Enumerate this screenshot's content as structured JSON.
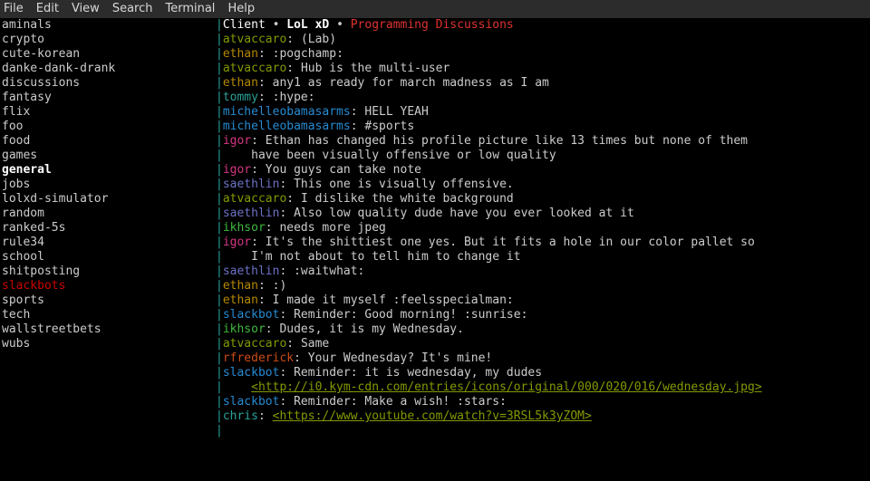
{
  "menubar": {
    "items": [
      "File",
      "Edit",
      "View",
      "Search",
      "Terminal",
      "Help"
    ]
  },
  "channels": [
    {
      "name": "aminals",
      "style": "ch"
    },
    {
      "name": "crypto",
      "style": "ch"
    },
    {
      "name": "cute-korean",
      "style": "ch"
    },
    {
      "name": "danke-dank-drank",
      "style": "ch"
    },
    {
      "name": "discussions",
      "style": "ch"
    },
    {
      "name": "fantasy",
      "style": "ch"
    },
    {
      "name": "flix",
      "style": "ch"
    },
    {
      "name": "foo",
      "style": "ch"
    },
    {
      "name": "food",
      "style": "ch"
    },
    {
      "name": "games",
      "style": "ch"
    },
    {
      "name": "general",
      "style": "ch-general"
    },
    {
      "name": "jobs",
      "style": "ch"
    },
    {
      "name": "lolxd-simulator",
      "style": "ch"
    },
    {
      "name": "random",
      "style": "ch"
    },
    {
      "name": "ranked-5s",
      "style": "ch"
    },
    {
      "name": "rule34",
      "style": "ch"
    },
    {
      "name": "school",
      "style": "ch"
    },
    {
      "name": "shitposting",
      "style": "ch"
    },
    {
      "name": "slackbots",
      "style": "ch-slackbots"
    },
    {
      "name": "sports",
      "style": "ch"
    },
    {
      "name": "tech",
      "style": "ch"
    },
    {
      "name": "wallstreetbets",
      "style": "ch"
    },
    {
      "name": "wubs",
      "style": "ch"
    }
  ],
  "header": {
    "client": "Client",
    "bullet": " • ",
    "lol": "LoL xD",
    "bullet2": " • ",
    "prog": "Programming Discussions"
  },
  "messages": [
    {
      "user": "atvaccaro",
      "uclass": "u-atv",
      "text": "(Lab)"
    },
    {
      "user": "ethan",
      "uclass": "u-ethan",
      "text": ":pogchamp:"
    },
    {
      "user": "atvaccaro",
      "uclass": "u-atv",
      "text": "Hub is the multi-user"
    },
    {
      "user": "ethan",
      "uclass": "u-ethan",
      "text": "any1 as ready for march madness as I am"
    },
    {
      "user": "tommy",
      "uclass": "u-tommy",
      "text": ":hype:"
    },
    {
      "user": "michelleobamasarms",
      "uclass": "u-mob",
      "text": "HELL YEAH"
    },
    {
      "user": "michelleobamasarms",
      "uclass": "u-mob",
      "text": "#sports"
    },
    {
      "user": "igor",
      "uclass": "u-igor",
      "text": "Ethan has changed his profile picture like 13 times but none of them"
    },
    {
      "cont": true,
      "text": "have been visually offensive or low quality"
    },
    {
      "user": "igor",
      "uclass": "u-igor",
      "text": "You guys can take note"
    },
    {
      "user": "saethlin",
      "uclass": "u-saeth",
      "text": "This one is visually offensive."
    },
    {
      "user": "atvaccaro",
      "uclass": "u-atv",
      "text": "I dislike the white background"
    },
    {
      "user": "saethlin",
      "uclass": "u-saeth",
      "text": "Also low quality dude have you ever looked at it"
    },
    {
      "user": "ikhsor",
      "uclass": "u-ikh",
      "text": "needs more jpeg"
    },
    {
      "user": "igor",
      "uclass": "u-igor",
      "text": "It's the shittiest one yes. But it fits a hole in our color pallet so"
    },
    {
      "cont": true,
      "text": "I'm not about to tell him to change it"
    },
    {
      "user": "saethlin",
      "uclass": "u-saeth",
      "text": ":waitwhat:"
    },
    {
      "user": "ethan",
      "uclass": "u-ethan",
      "text": ":)"
    },
    {
      "user": "ethan",
      "uclass": "u-ethan",
      "text": "I made it myself :feelsspecialman:"
    },
    {
      "user": "slackbot",
      "uclass": "u-slackbot",
      "text": "Reminder: Good morning! :sunrise:"
    },
    {
      "user": "ikhsor",
      "uclass": "u-ikh",
      "text": "Dudes, it is my Wednesday."
    },
    {
      "user": "atvaccaro",
      "uclass": "u-atv",
      "text": "Same"
    },
    {
      "user": "rfrederick",
      "uclass": "u-rfred",
      "text": "Your Wednesday? It's mine!"
    },
    {
      "user": "slackbot",
      "uclass": "u-slackbot",
      "text": "Reminder: it is wednesday, my dudes"
    },
    {
      "cont": true,
      "link": true,
      "text": "<http://i0.kym-cdn.com/entries/icons/original/000/020/016/wednesday.jpg>"
    },
    {
      "user": "slackbot",
      "uclass": "u-slackbot",
      "text": "Reminder: Make a wish! :stars:"
    },
    {
      "user": "chris",
      "uclass": "u-chris",
      "link": true,
      "text": "<https://www.youtube.com/watch?v=3RSL5k3yZOM>"
    },
    {
      "empty": true
    }
  ]
}
